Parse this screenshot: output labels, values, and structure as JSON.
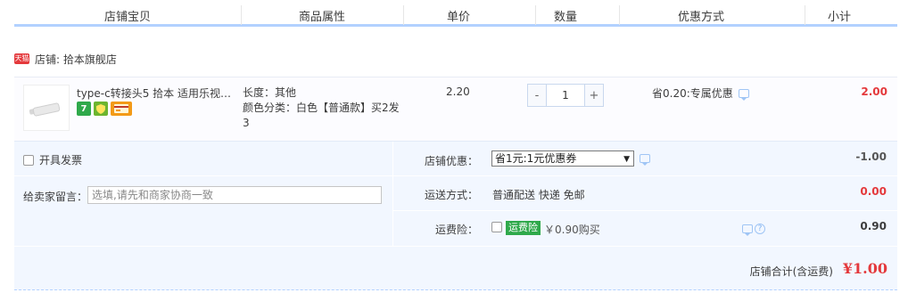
{
  "header": {
    "columns": [
      "店铺宝贝",
      "商品属性",
      "单价",
      "数量",
      "优惠方式",
      "小计"
    ]
  },
  "shop": {
    "badge": "天猫",
    "label": "店铺: 拾本旗舰店"
  },
  "item": {
    "title": "type-c转接头5 拾本 适用乐视小...",
    "icons": [
      "seven-day-return-icon",
      "guarantee-icon",
      "credit-card-icon"
    ],
    "attr_length": "长度：其他",
    "attr_color": "颜色分类：白色【普通款】买2发3",
    "price": "2.20",
    "quantity": "1",
    "minus": "-",
    "plus": "+",
    "discount": "省0.20:专属优惠",
    "subtotal": "2.00"
  },
  "options": {
    "invoice_label": "开具发票",
    "message_label": "给卖家留言：",
    "message_placeholder": "选填,请先和商家协商一致",
    "coupon_label": "店铺优惠：",
    "coupon_selected": "省1元:1元优惠券",
    "coupon_amount": "-1.00",
    "shipping_label": "运送方式：",
    "shipping_method": "普通配送 快递 免邮",
    "shipping_amount": "0.00",
    "insurance_label": "运费险：",
    "insurance_badge": "运费险",
    "insurance_price": "￥0.90购买",
    "insurance_amount": "0.90"
  },
  "total": {
    "label": "店铺合计(含运费)",
    "value": "¥1.00"
  },
  "colors": {
    "accent_blue": "#b2d1ff",
    "price_red": "#e4393c",
    "panel_bg": "#f2f7ff",
    "badge_green": "#2fa94b"
  }
}
